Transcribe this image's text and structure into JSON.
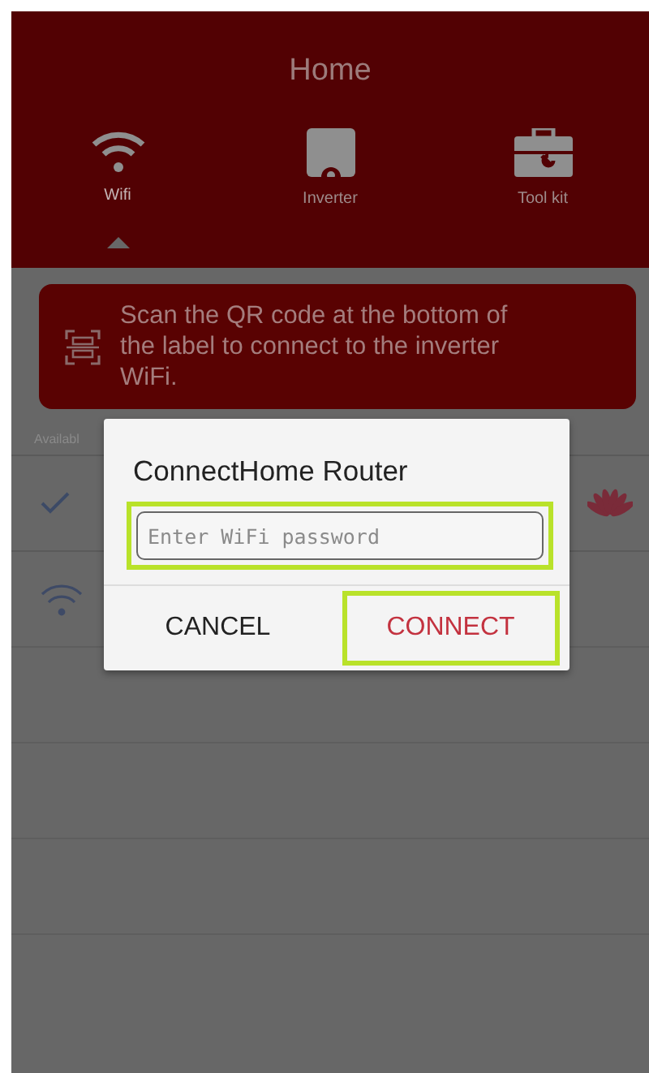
{
  "header": {
    "title": "Home"
  },
  "tabs": [
    {
      "label": "Wifi",
      "kind": "wifi",
      "selected": true
    },
    {
      "label": "Inverter",
      "kind": "inverter",
      "selected": false
    },
    {
      "label": "Tool kit",
      "kind": "toolkit",
      "selected": false
    }
  ],
  "banner": {
    "text": "Scan the QR code at the bottom of the label to connect to the inverter WiFi."
  },
  "list": {
    "heading": "Availabl",
    "rows": [
      {
        "connected": true
      },
      {
        "connected": false
      }
    ]
  },
  "dialog": {
    "title": "ConnectHome Router",
    "password": {
      "placeholder": "Enter WiFi password",
      "highlighted": true
    },
    "buttons": [
      {
        "label": "CANCEL",
        "kind": "cancel",
        "highlighted": false
      },
      {
        "label": "CONNECT",
        "kind": "confirm",
        "highlighted": true
      }
    ]
  }
}
